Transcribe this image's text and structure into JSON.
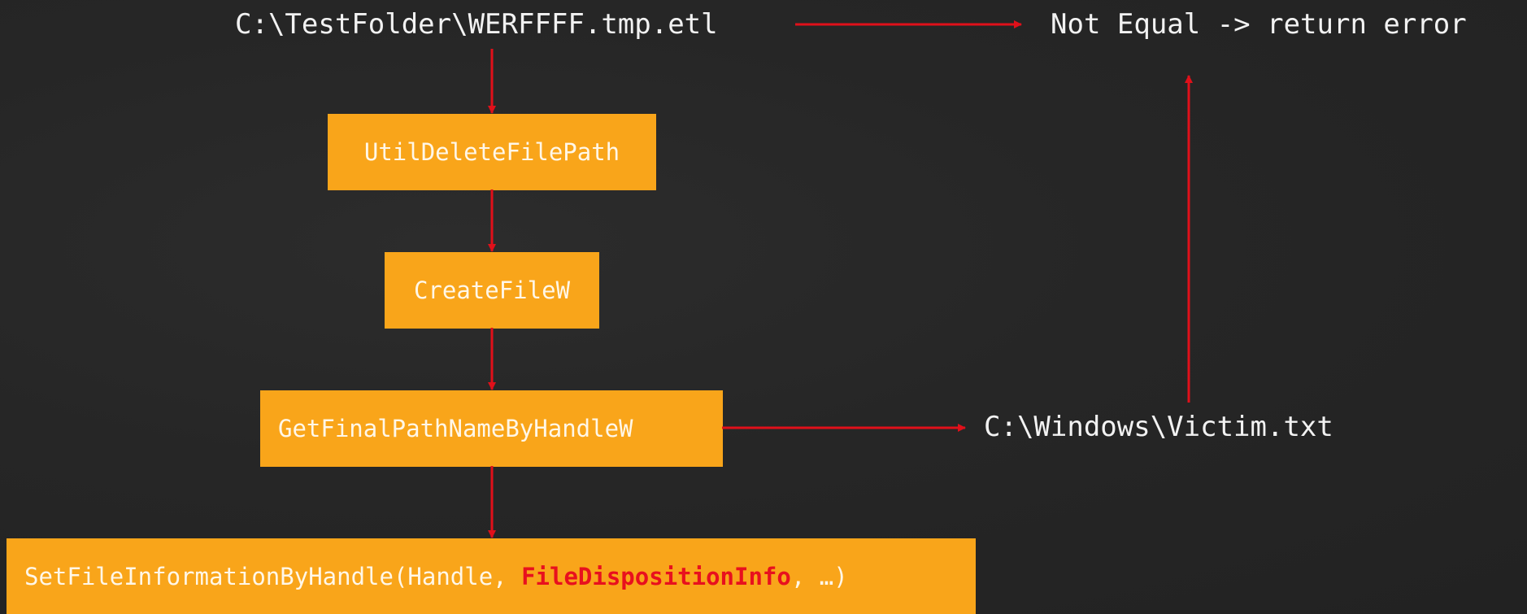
{
  "source_path": "C:\\TestFolder\\WERFFFF.tmp.etl",
  "result_text": "Not Equal -> return error",
  "resolved_path": "C:\\Windows\\Victim.txt",
  "steps": {
    "util_delete": "UtilDeleteFilePath",
    "create_file": "CreateFileW",
    "get_final_path": "GetFinalPathNameByHandleW",
    "set_info_prefix": "SetFileInformationByHandle(Handle, ",
    "set_info_highlight": "FileDispositionInfo",
    "set_info_suffix": ", …)"
  },
  "colors": {
    "box": "#f9a51a",
    "arrow": "#e0101a",
    "highlight": "#e8101e",
    "background": "#262626"
  }
}
